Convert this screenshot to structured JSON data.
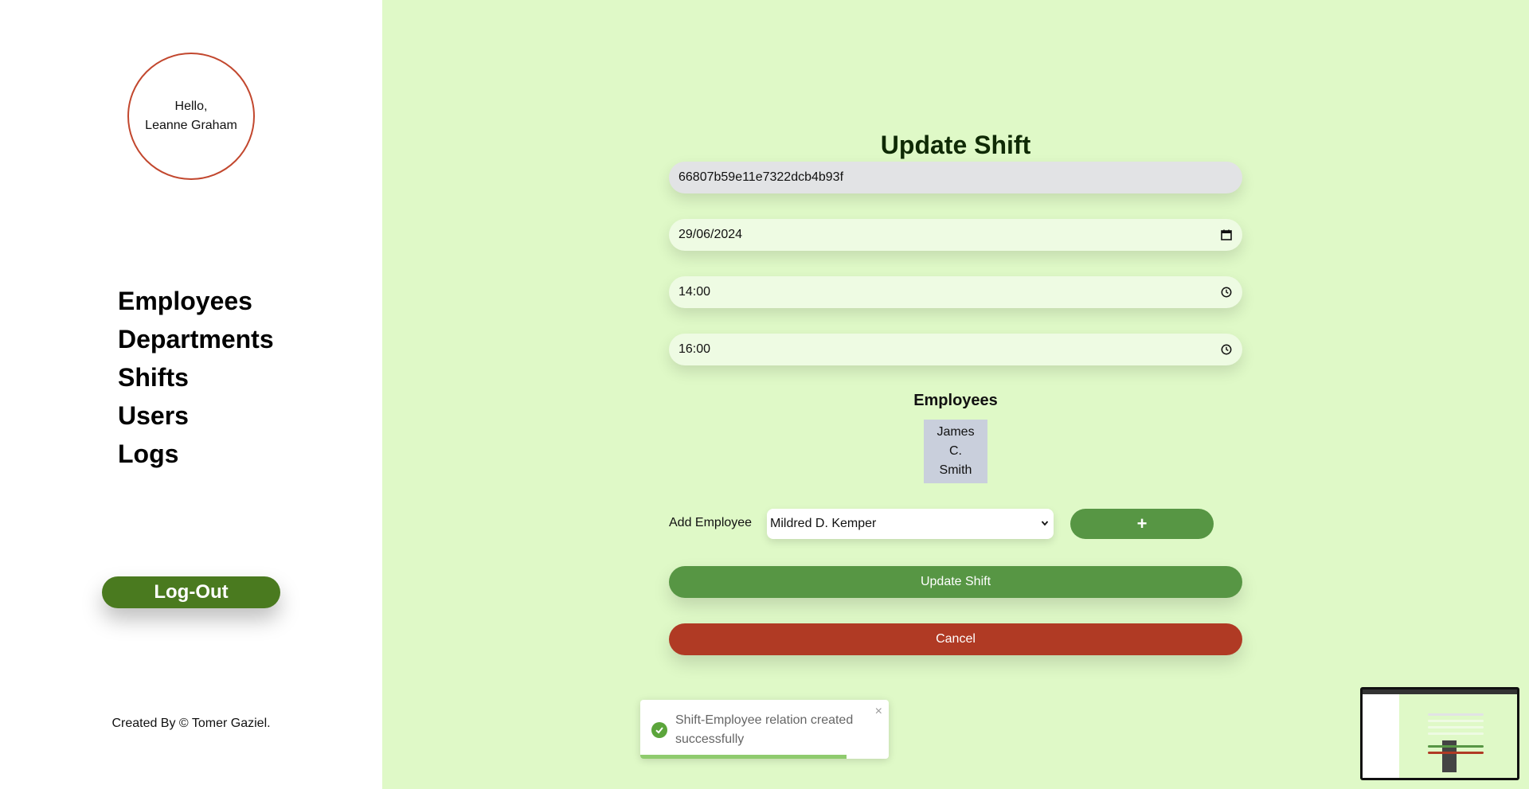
{
  "sidebar": {
    "greeting_line1": "Hello,",
    "greeting_line2": "Leanne Graham",
    "nav": [
      {
        "label": "Employees"
      },
      {
        "label": "Departments"
      },
      {
        "label": "Shifts"
      },
      {
        "label": "Users"
      },
      {
        "label": "Logs"
      }
    ],
    "logout_label": "Log-Out",
    "footer": "Created By © Tomer Gaziel."
  },
  "form": {
    "title": "Update Shift",
    "id_value": "66807b59e11e7322dcb4b93f",
    "date_value": "29/06/2024",
    "start_time": "14:00",
    "end_time": "16:00",
    "employees_heading": "Employees",
    "employee_card": {
      "line1": "James",
      "line2": "C.",
      "line3": "Smith"
    },
    "add_employee_label": "Add Employee",
    "add_employee_selected": "Mildred D. Kemper",
    "add_button_label": "+",
    "update_button_label": "Update Shift",
    "cancel_button_label": "Cancel"
  },
  "toast": {
    "message": "Shift-Employee relation created successfully",
    "close_label": "×",
    "progress_fraction": 0.83
  },
  "colors": {
    "background": "#dff9c7",
    "accent_green": "#579644",
    "logout_green": "#4a7a1f",
    "cancel_red": "#b03a24",
    "greeting_border": "#c2472e"
  },
  "icons": {
    "date": "calendar-icon",
    "time": "clock-icon",
    "toast": "check-circle-icon",
    "select": "chevron-down-icon"
  }
}
